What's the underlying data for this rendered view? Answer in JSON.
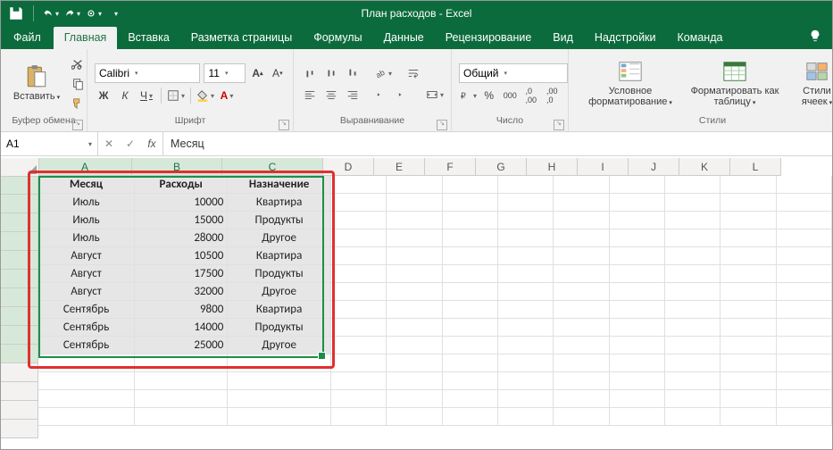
{
  "app": {
    "title": "План расходов - Excel"
  },
  "tabs": {
    "file": "Файл",
    "home": "Главная",
    "insert": "Вставка",
    "layout": "Разметка страницы",
    "formulas": "Формулы",
    "data": "Данные",
    "review": "Рецензирование",
    "view": "Вид",
    "addins": "Надстройки",
    "team": "Команда"
  },
  "ribbon": {
    "clipboard": {
      "paste": "Вставить",
      "cap": "Буфер обмена"
    },
    "font": {
      "name": "Calibri",
      "size": "11",
      "cap": "Шрифт",
      "bold": "Ж",
      "italic": "К",
      "underline": "Ч"
    },
    "align": {
      "cap": "Выравнивание"
    },
    "number": {
      "format": "Общий",
      "cap": "Число"
    },
    "styles": {
      "cond": "Условное форматирование",
      "asTable": "Форматировать как таблицу",
      "cellStyles": "Стили ячеек",
      "cap": "Стили"
    }
  },
  "fbar": {
    "name": "A1",
    "value": "Месяц"
  },
  "cols": [
    "A",
    "B",
    "C",
    "D",
    "E",
    "F",
    "G",
    "H",
    "I",
    "J",
    "K",
    "L"
  ],
  "table": {
    "headers": [
      "Месяц",
      "Расходы",
      "Назначение"
    ],
    "rows": [
      [
        "Июль",
        "10000",
        "Квартира"
      ],
      [
        "Июль",
        "15000",
        "Продукты"
      ],
      [
        "Июль",
        "28000",
        "Другое"
      ],
      [
        "Август",
        "10500",
        "Квартира"
      ],
      [
        "Август",
        "17500",
        "Продукты"
      ],
      [
        "Август",
        "32000",
        "Другое"
      ],
      [
        "Сентябрь",
        "9800",
        "Квартира"
      ],
      [
        "Сентябрь",
        "14000",
        "Продукты"
      ],
      [
        "Сентябрь",
        "25000",
        "Другое"
      ]
    ]
  }
}
